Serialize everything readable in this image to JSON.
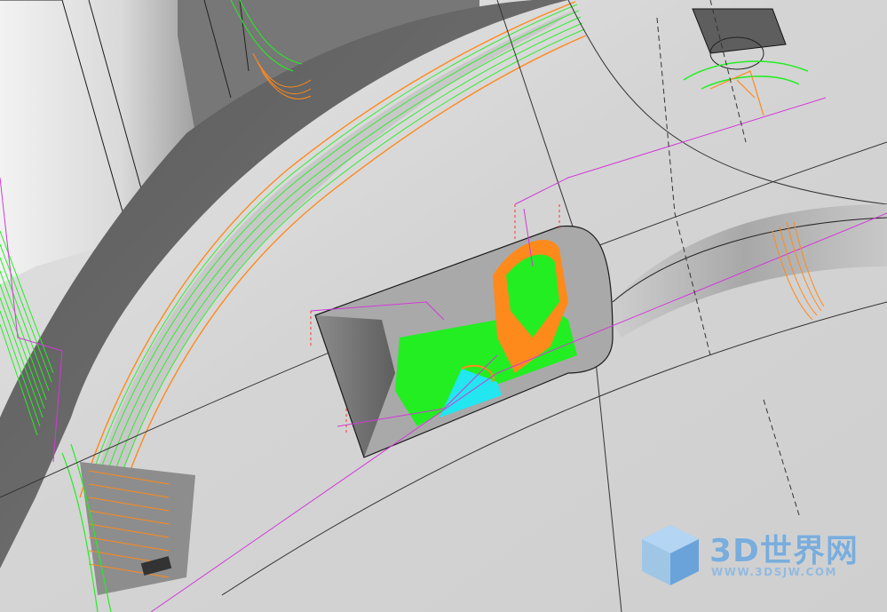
{
  "viewport": {
    "background_color": "#9a9a9a",
    "surface_light": "#e4e4e4",
    "surface_dark": "#6b6b6b",
    "edge_color": "#1a1a1a"
  },
  "toolpath_colors": {
    "cutting": "#22ee22",
    "link": "#ff8a1c",
    "rapid": "#d23ad8",
    "plunge": "#ff3333",
    "lead": "#22e6f0"
  },
  "watermark": {
    "title": "3D世界网",
    "url": "WWW.3DSJW.COM",
    "logo_icon": "cube-logo-icon",
    "color": "#6aa8e0"
  }
}
